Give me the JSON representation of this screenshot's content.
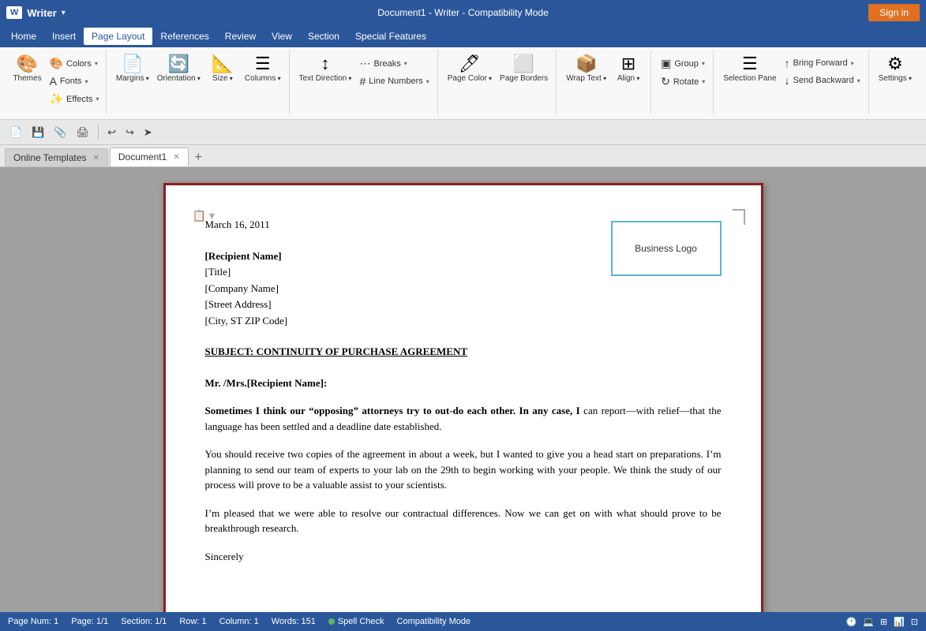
{
  "titlebar": {
    "app_name": "Writer",
    "doc_title": "Document1 - Writer - Compatibility Mode",
    "sign_in": "Sign in"
  },
  "menu": {
    "items": [
      "Home",
      "Insert",
      "Page Layout",
      "References",
      "Review",
      "View",
      "Section",
      "Special Features"
    ]
  },
  "ribbon": {
    "groups": [
      {
        "label": "Themes",
        "buttons": [
          {
            "icon": "🎨",
            "label": "Themes",
            "arrow": true
          }
        ],
        "small_buttons": [
          {
            "icon": "🎨",
            "label": "Colors",
            "arrow": true
          },
          {
            "icon": "A",
            "label": "Fonts",
            "arrow": true
          },
          {
            "icon": "✨",
            "label": "Effects",
            "arrow": true
          }
        ]
      },
      {
        "label": "",
        "buttons": [
          {
            "icon": "📄",
            "label": "Margins",
            "arrow": true
          },
          {
            "icon": "🔄",
            "label": "Orientation",
            "arrow": true
          },
          {
            "icon": "📐",
            "label": "Size",
            "arrow": true
          },
          {
            "icon": "☰",
            "label": "Columns",
            "arrow": true
          }
        ]
      },
      {
        "label": "",
        "buttons": [
          {
            "icon": "↕",
            "label": "Text Direction",
            "arrow": true
          }
        ],
        "small_buttons": [
          {
            "icon": "⋯",
            "label": "Breaks",
            "arrow": true
          },
          {
            "icon": "#",
            "label": "Line Numbers",
            "arrow": true
          }
        ]
      },
      {
        "label": "",
        "buttons": [
          {
            "icon": "🖊",
            "label": "Page Color",
            "arrow": true
          },
          {
            "icon": "⬜",
            "label": "Page Borders",
            "arrow": false
          }
        ]
      },
      {
        "label": "",
        "buttons": [
          {
            "icon": "📦",
            "label": "Wrap Text",
            "arrow": true
          },
          {
            "icon": "⊞",
            "label": "Align",
            "arrow": true
          }
        ]
      },
      {
        "label": "",
        "small_buttons": [
          {
            "icon": "▣",
            "label": "Group",
            "arrow": true
          },
          {
            "icon": "↻",
            "label": "Rotate",
            "arrow": true
          }
        ],
        "buttons": []
      },
      {
        "label": "",
        "buttons": [
          {
            "icon": "☰",
            "label": "Selection Pane",
            "arrow": false
          }
        ],
        "small_buttons": [
          {
            "icon": "↑",
            "label": "Bring Forward",
            "arrow": true
          },
          {
            "icon": "↓",
            "label": "Send Backward",
            "arrow": true
          }
        ]
      },
      {
        "label": "",
        "buttons": [
          {
            "icon": "⚙",
            "label": "Settings",
            "arrow": true
          }
        ]
      }
    ]
  },
  "quickaccess": {
    "buttons": [
      "📄",
      "💾",
      "📎",
      "🖨",
      "↩",
      "↪",
      "➤"
    ]
  },
  "tabs": [
    {
      "label": "Online Templates",
      "active": false,
      "closeable": true
    },
    {
      "label": "Document1",
      "active": true,
      "closeable": true
    }
  ],
  "document": {
    "date": "March 16, 2011",
    "logo_text": "Business Logo",
    "recipient_name": "[Recipient Name]",
    "title": "[Title]",
    "company": "[Company Name]",
    "street": "[Street Address]",
    "city": "[City, ST  ZIP Code]",
    "subject": "SUBJECT: CONTINUITY OF PURCHASE AGREEMENT",
    "salutation": "Mr. /Mrs.[Recipient Name]:",
    "paragraph1_bold": "Sometimes I think our “opposing” attorneys try to out-do each other. In any case, I",
    "paragraph1_rest": " can report—with relief—that the language has been settled and a deadline date established.",
    "paragraph2": "You should receive two copies of the agreement in about a week, but I wanted to give you a head start on preparations. I’m planning to send our team of experts to your lab on the 29th to begin working with your people. We think the study of our process will prove to be a valuable assist to your scientists.",
    "paragraph3": "I’m pleased that we were able to resolve our contractual differences. Now we can get on with what should prove to be breakthrough research.",
    "closing": "Sincerely"
  },
  "statusbar": {
    "page_num": "Page Num: 1",
    "page": "Page: 1/1",
    "section": "Section: 1/1",
    "row": "Row: 1",
    "column": "Column: 1",
    "words": "Words: 151",
    "spell_check": "Spell Check",
    "mode": "Compatibility Mode"
  }
}
